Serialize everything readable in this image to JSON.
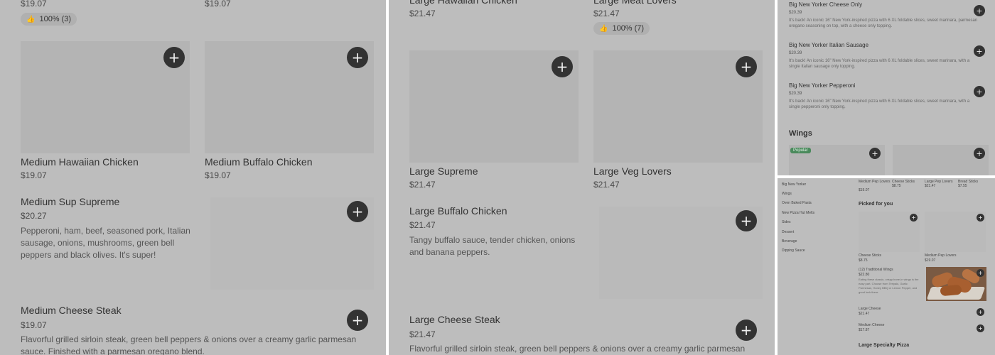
{
  "panel1": {
    "top_price_left": "$19.07",
    "top_price_right": "$19.07",
    "rating_badge": "100% (3)",
    "cards": [
      {
        "name": "Medium Hawaiian Chicken",
        "price": "$19.07"
      },
      {
        "name": "Medium Buffalo Chicken",
        "price": "$19.07"
      }
    ],
    "items": [
      {
        "name": "Medium Sup Supreme",
        "price": "$20.27",
        "desc": "Pepperoni, ham, beef, seasoned pork, Italian sausage, onions, mushrooms, green bell peppers and black olives. It's super!"
      },
      {
        "name": "Medium Cheese Steak",
        "price": "$19.07",
        "desc": "Flavorful grilled sirloin steak, green bell peppers & onions over a creamy garlic parmesan sauce. Finished with a parmesan oregano blend."
      }
    ]
  },
  "panel2": {
    "top_name_left": "Large Hawaiian Chicken",
    "top_price_left": "$21.47",
    "top_name_right": "Large Meat Lovers",
    "top_price_right": "$21.47",
    "rating_badge": "100% (7)",
    "cards": [
      {
        "name": "Large Supreme",
        "price": "$21.47"
      },
      {
        "name": "Large Veg Lovers",
        "price": "$21.47"
      }
    ],
    "items": [
      {
        "name": "Large Buffalo Chicken",
        "price": "$21.47",
        "desc": "Tangy buffalo sauce, tender chicken, onions and banana peppers."
      },
      {
        "name": "Large Cheese Steak",
        "price": "$21.47",
        "desc": "Flavorful grilled sirloin steak, green bell peppers & onions over a creamy garlic parmesan"
      }
    ]
  },
  "panel3": {
    "items": [
      {
        "name": "Big New Yorker Cheese Only",
        "price": "$20.39",
        "desc": "It's back! An iconic 16\" New York-inspired pizza with 6 XL foldable slices, sweet marinara, parmesan oregano seasoning on top, with a cheese only topping."
      },
      {
        "name": "Big New Yorker Italian Sausage",
        "price": "$20.39",
        "desc": "It's back! An iconic 16\" New York-inspired pizza with 6 XL foldable slices, sweet marinara, with a single Italian sausage only topping."
      },
      {
        "name": "Big New Yorker Pepperoni",
        "price": "$20.39",
        "desc": "It's back! An iconic 16\" New York-inspired pizza with 6 XL foldable slices, sweet marinara, with a single pepperoni only topping."
      }
    ],
    "section_title": "Wings",
    "popular_badge": "Popular"
  },
  "panel4": {
    "nav": [
      "Big New Yorker",
      "Wings",
      "Oven Baked Pasta",
      "New Pizza Hut Melts",
      "Sides",
      "Dessert",
      "Beverage",
      "Dipping Sauce"
    ],
    "top_row": [
      {
        "name": "Medium Pep Lovers",
        "price": "$19.07"
      },
      {
        "name": "Cheese Sticks",
        "price": "$8.75"
      },
      {
        "name": "Large Pep Lovers",
        "price": "$21.47"
      },
      {
        "name": "Bread Sticks",
        "price": "$7.55"
      }
    ],
    "picked_title": "Picked for you",
    "picked_cards": [
      {
        "name": "Cheese Sticks",
        "price": "$8.75"
      },
      {
        "name": "Medium Pep Lovers",
        "price": "$19.07"
      }
    ],
    "wings_item": {
      "name": "(12) Traditional Wings",
      "price": "$22.80",
      "desc": "Eating these classic, crispy bone-in wings is the easy part. Choose from Teriyaki, Garlic Parmesan, Honey BBQ or Lemon Pepper, and good luck there."
    },
    "list_items": [
      {
        "name": "Large Cheese",
        "price": "$21.47"
      },
      {
        "name": "Medium Cheese",
        "price": "$17.87"
      }
    ],
    "section_title": "Large Specialty Pizza"
  }
}
